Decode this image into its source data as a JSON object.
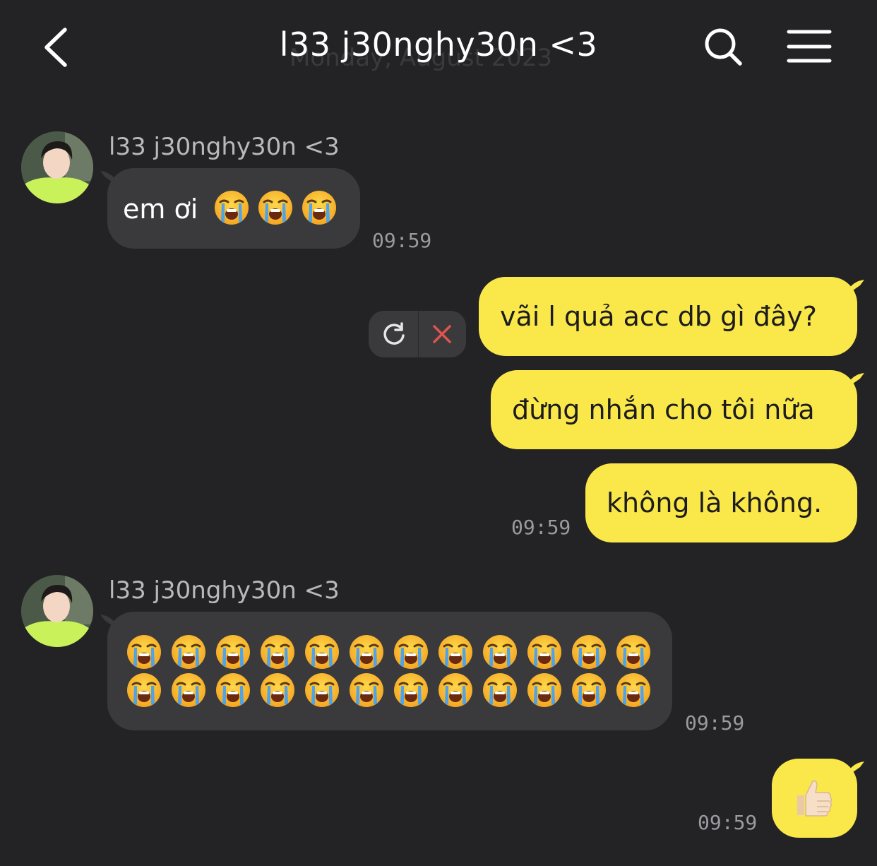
{
  "header": {
    "title": "l33 j30nghy30n <3",
    "back_icon": "chevron-left-icon",
    "search_icon": "search-icon",
    "menu_icon": "hamburger-menu-icon",
    "date_separator": "Monday, August 2023"
  },
  "messages": [
    {
      "direction": "incoming",
      "sender": "l33 j30nghy30n <3",
      "text": "em ơi",
      "emoji": [
        "loudly-crying-face",
        "loudly-crying-face",
        "loudly-crying-face"
      ],
      "time": "09:59"
    },
    {
      "direction": "outgoing",
      "texts": [
        "vãi l quả acc db gì đây?",
        "đừng nhắn cho tôi nữa",
        "không là không."
      ],
      "time": "09:59",
      "failed_actions": {
        "retry_icon": "retry-icon",
        "delete_icon": "close-icon"
      }
    },
    {
      "direction": "incoming",
      "sender": "l33 j30nghy30n <3",
      "emoji_count": 24,
      "emoji": "loudly-crying-face",
      "time": "09:59"
    },
    {
      "direction": "outgoing",
      "emoji": "thumbs-up",
      "time": "09:59"
    }
  ],
  "colors": {
    "background": "#232325",
    "incoming_bubble": "#3a3a3c",
    "outgoing_bubble": "#fae84a",
    "delete_red": "#e0534f"
  }
}
